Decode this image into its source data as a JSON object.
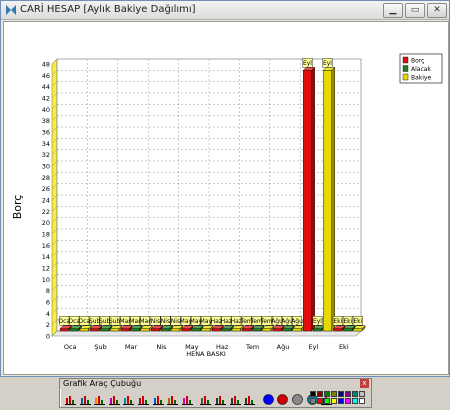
{
  "window": {
    "title": "CARİ HESAP [Aylık Bakiye Dağılımı]",
    "minimize": "▁",
    "maximize": "▭",
    "close": "✕"
  },
  "chart_data": {
    "type": "bar",
    "title": "",
    "xlabel": "HENA BASKI",
    "ylabel": "Borç",
    "ylim": [
      0,
      48
    ],
    "ytick_step": 2,
    "grid": true,
    "legend_position": "top-right",
    "categories": [
      "Oca",
      "Şub",
      "Mar",
      "Nis",
      "May",
      "Haz",
      "Tem",
      "Ağu",
      "Eyl",
      "Eki"
    ],
    "series": [
      {
        "name": "Borç",
        "color": "#e01010",
        "values": [
          0,
          0,
          0,
          0,
          0,
          0,
          0,
          0,
          46,
          0
        ]
      },
      {
        "name": "Alacak",
        "color": "#208020",
        "values": [
          0,
          0,
          0,
          0,
          0,
          0,
          0,
          0,
          0,
          0
        ]
      },
      {
        "name": "Bakiye",
        "color": "#e6d800",
        "values": [
          0,
          0,
          0,
          0,
          0,
          0,
          0,
          0,
          46,
          0
        ]
      }
    ],
    "data_labels": [
      [
        "Oca",
        "Oca",
        "Oca"
      ],
      [
        "Şub",
        "Şub",
        "Şub"
      ],
      [
        "Mar",
        "Mar",
        "Mar"
      ],
      [
        "Nis",
        "Nis",
        "Nis"
      ],
      [
        "May",
        "May",
        "May"
      ],
      [
        "Haz",
        "Haz",
        "Haz"
      ],
      [
        "Tem",
        "Tem",
        "Tem"
      ],
      [
        "Ağu",
        "Ağu",
        "Ağu"
      ],
      [
        "Eyl",
        "Eyl",
        "Eyl"
      ],
      [
        "Eki",
        "Eki",
        "Eki"
      ]
    ]
  },
  "toolbar": {
    "title": "Grafik Araç Çubuğu",
    "close": "x",
    "buttons": [
      "bar-chart-icon",
      "area-chart-icon",
      "pie-chart-icon",
      "doughnut-chart-icon",
      "scatter-chart-icon",
      "3d-bar-chart-icon",
      "line-chart-icon",
      "radar-chart-icon",
      "combo-chart-icon",
      "grid-lines-icon",
      "horizontal-grid-icon",
      "vertical-grid-icon",
      "no-grid-icon",
      "color-blue-icon",
      "color-red-icon",
      "color-gray-icon",
      "wall-color-icon",
      "print-icon"
    ],
    "palette": [
      "#000000",
      "#800000",
      "#008000",
      "#808000",
      "#000080",
      "#800080",
      "#008080",
      "#c0c0c0",
      "#808080",
      "#ff0000",
      "#00ff00",
      "#ffff00",
      "#0000ff",
      "#ff00ff",
      "#00ffff",
      "#ffffff"
    ]
  }
}
